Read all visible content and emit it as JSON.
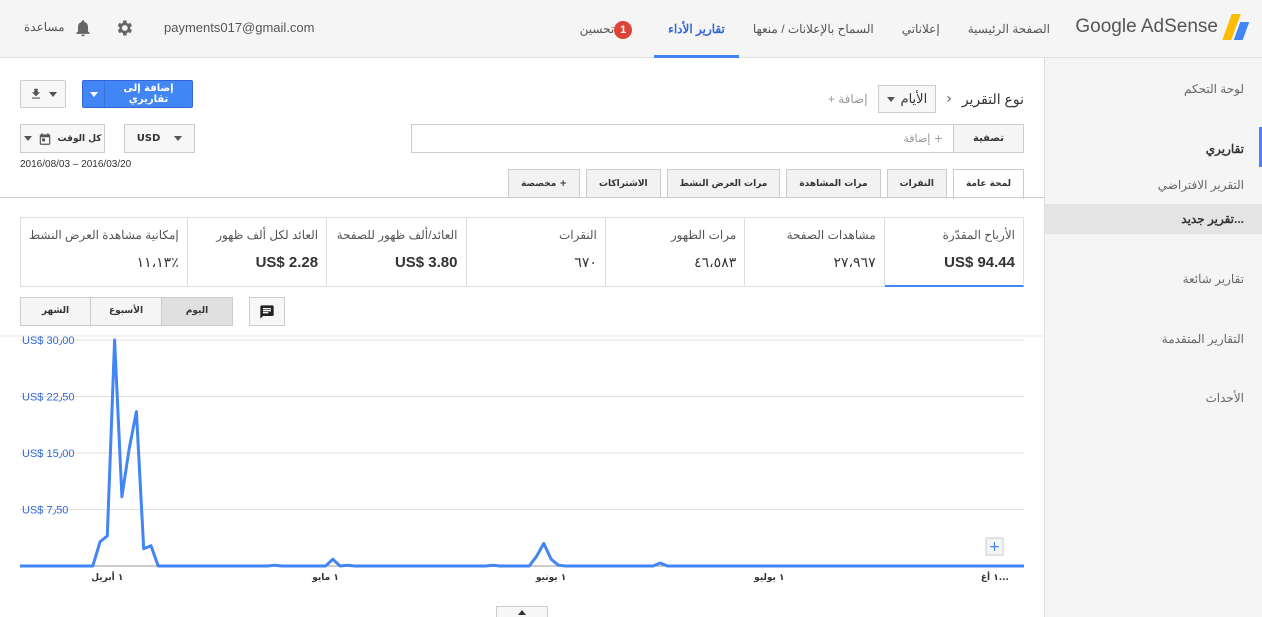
{
  "topbar": {
    "logo_text": "Google AdSense",
    "nav": [
      {
        "label": "الصفحة الرئيسية",
        "active": false
      },
      {
        "label": "إعلاناتي",
        "active": false
      },
      {
        "label": "السماح بالإعلانات / منعها",
        "active": false
      },
      {
        "label": "تقارير الأداء",
        "active": true
      },
      {
        "label": "تحسين",
        "active": false
      }
    ],
    "optimize_badge": "1",
    "email": "payments017@gmail.com",
    "help": "مساعدة",
    "icons": {
      "settings": "gear-icon",
      "notifications": "bell-icon"
    }
  },
  "sidebar": {
    "items": [
      {
        "label": "لوحة التحكم"
      },
      {
        "label": "تقاريري"
      },
      {
        "label": "التقرير الافتراضي"
      },
      {
        "label": "تقرير جديد..."
      },
      {
        "label": "تقارير شائعة"
      },
      {
        "label": "التقارير المتقدمة"
      },
      {
        "label": "الأحداث"
      }
    ]
  },
  "header": {
    "report_type_label": "نوع التقرير",
    "dimension": "الأيام",
    "add_label": "+ إضافة",
    "add_to_reports": "إضافة إلى تقاريري",
    "filter_label": "تصفية",
    "filter_add": "+ إضافة",
    "currency": "USD",
    "range_label": "كل الوقت",
    "date_range": "2016/08/03 – 2016/03/20"
  },
  "tabs": [
    {
      "label": "لمحة عامة",
      "active": true
    },
    {
      "label": "النقرات",
      "active": false
    },
    {
      "label": "مرات المشاهدة",
      "active": false
    },
    {
      "label": "مرات العرض النشط",
      "active": false
    },
    {
      "label": "الاشتراكات",
      "active": false
    },
    {
      "label": "+ مخصصة",
      "active": false
    }
  ],
  "metrics": [
    {
      "label": "الأرباح المقدّرة",
      "value": "US$ 94.44",
      "selected": true,
      "bold": true
    },
    {
      "label": "مشاهدات الصفحة",
      "value": "٢٧،٩٦٧",
      "selected": false,
      "bold": false
    },
    {
      "label": "مرات الظهور",
      "value": "٤٦،٥٨٣",
      "selected": false,
      "bold": false
    },
    {
      "label": "النقرات",
      "value": "٦٧٠",
      "selected": false,
      "bold": false
    },
    {
      "label": "العائد/ألف ظهور للصفحة",
      "value": "US$ 3.80",
      "selected": false,
      "bold": true
    },
    {
      "label": "العائد لكل ألف ظهور",
      "value": "US$ 2.28",
      "selected": false,
      "bold": true
    },
    {
      "label": "إمكانية مشاهدة العرض النشط",
      "value": "٪١١،١٣",
      "selected": false,
      "bold": false
    }
  ],
  "period": [
    {
      "label": "الشهر",
      "active": false
    },
    {
      "label": "الأسبوع",
      "active": false
    },
    {
      "label": "اليوم",
      "active": true
    }
  ],
  "chart_data": {
    "type": "line",
    "title": "",
    "xlabel": "",
    "ylabel": "",
    "ylim": [
      0,
      30
    ],
    "yticks": [
      "US$ 7٫50",
      "US$ 15٫00",
      "US$ 22٫50",
      "US$ 30٫00"
    ],
    "ytick_values": [
      7.5,
      15,
      22.5,
      30
    ],
    "xticks": [
      "١ أبريل",
      "١ مايو",
      "١ يونيو",
      "١ يوليو",
      "١ أغ..."
    ],
    "xtick_days": [
      12,
      42,
      73,
      103,
      134
    ],
    "grid": true,
    "color": "#4285f4",
    "series": [
      {
        "values": [
          0,
          0,
          0,
          0,
          0,
          0,
          0,
          0,
          0,
          0,
          0,
          3.2,
          4.0,
          30.0,
          9.2,
          15.5,
          20.5,
          2.3,
          2.7,
          0,
          0,
          0,
          0,
          0,
          0,
          0,
          0,
          0,
          0,
          0,
          0,
          0,
          0,
          0,
          0,
          0.1,
          0,
          0,
          0,
          0,
          0,
          0,
          0,
          0.9,
          0,
          0.1,
          0,
          0,
          0,
          0,
          0,
          0,
          0,
          0,
          0,
          0,
          0,
          0,
          0,
          0,
          0,
          0,
          0,
          0,
          0,
          0.1,
          0,
          0,
          0,
          0,
          0,
          1.3,
          3.0,
          0.9,
          0.1,
          0,
          0,
          0,
          0,
          0,
          0,
          0,
          0,
          0,
          0,
          0,
          0,
          0,
          0.4,
          0,
          0,
          0,
          0,
          0,
          0,
          0,
          0,
          0,
          0,
          0,
          0,
          0,
          0,
          0,
          0,
          0,
          0,
          0,
          0,
          0,
          0,
          0,
          0,
          0,
          0,
          0,
          0,
          0,
          0,
          0,
          0,
          0,
          0,
          0,
          0,
          0,
          0,
          0,
          0,
          0,
          0,
          0,
          0,
          0,
          0,
          0,
          0,
          0,
          0
        ]
      }
    ]
  }
}
